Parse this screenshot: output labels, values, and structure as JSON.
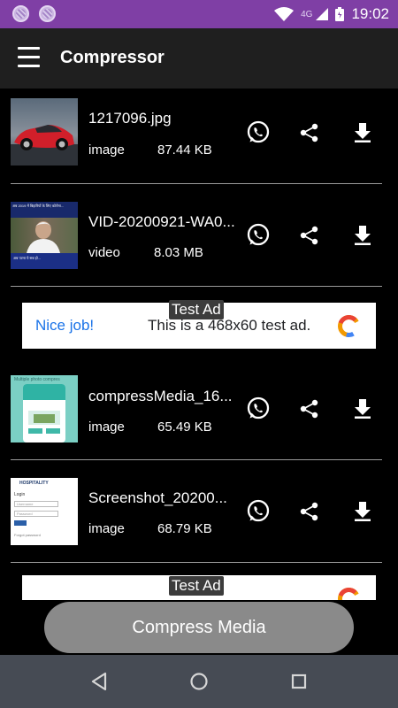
{
  "status_bar": {
    "network": "4G",
    "time": "19:02"
  },
  "app_bar": {
    "title": "Compressor",
    "menu_icon": "menu-icon"
  },
  "items": [
    {
      "name": "1217096.jpg",
      "type": "image",
      "size": "87.44 KB"
    },
    {
      "name": "VID-20200921-WA0...",
      "type": "video",
      "size": "8.03 MB"
    },
    {
      "name": "compressMedia_16...",
      "type": "image",
      "size": "65.49 KB"
    },
    {
      "name": "Screenshot_20200...",
      "type": "image",
      "size": "68.79 KB"
    }
  ],
  "thumbnails": {
    "video_caption": "अब 2019 में बिहारियों के लिए कोरोना...",
    "video_subcaption": "अब पटना ये सब हो...",
    "app_caption": "Multiple photo compres",
    "screenshot_brand": "HOSPITALITY",
    "screenshot_login": "Login",
    "screenshot_field1": "Username",
    "screenshot_field2": "Password",
    "screenshot_footer": "Forgot password"
  },
  "ads": [
    {
      "label": "Test Ad",
      "headline": "Nice job!",
      "body": "This is a 468x60 test ad."
    },
    {
      "label": "Test Ad"
    }
  ],
  "actions": {
    "share_whatsapp_icon": "whatsapp-icon",
    "share_icon": "share-icon",
    "download_icon": "download-icon"
  },
  "footer": {
    "compress_button": "Compress Media"
  },
  "colors": {
    "status_bar": "#7f3fa5",
    "app_bar": "#1f1f1f",
    "background": "#000000",
    "button": "#8a8a8a",
    "nav_bar": "#464b54",
    "ad_accent": "#1a73e8"
  }
}
